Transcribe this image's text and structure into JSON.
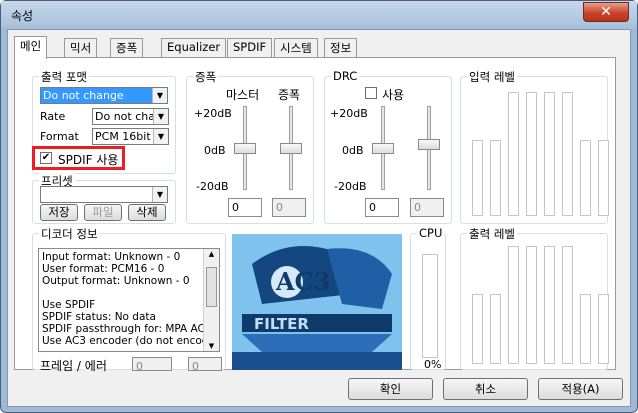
{
  "window": {
    "title": "속성",
    "close": "✕"
  },
  "tabs": [
    "메인",
    "믹서",
    "증폭",
    "Equalizer",
    "SPDIF",
    "시스템",
    "정보"
  ],
  "output_format": {
    "title": "출력 포맷",
    "format_combo": "Do not change",
    "rate_label": "Rate",
    "rate_combo": "Do not char",
    "format_label": "Format",
    "format_value": "PCM 16bit",
    "spdif_checkbox": "SPDIF 사용",
    "spdif_checked": true
  },
  "preset": {
    "title": "프리셋",
    "combo": "",
    "save": "저장",
    "file": "파일",
    "delete": "삭제"
  },
  "amp": {
    "title": "증폭",
    "master": "마스터",
    "gain": "증폭",
    "t20": "+20dB",
    "t0": "0dB",
    "tm20": "-20dB",
    "val1": "0",
    "val2": "0"
  },
  "drc": {
    "title": "DRC",
    "use": "사용",
    "t20": "+20dB",
    "t0": "0dB",
    "tm20": "-20dB",
    "val1": "0",
    "val2": "0"
  },
  "input_level": {
    "title": "입력 레벨"
  },
  "output_level": {
    "title": "출력 레벨"
  },
  "cpu": {
    "title": "CPU",
    "value": "0%"
  },
  "decoder": {
    "title": "디코더 정보",
    "lines": [
      "Input format: Unknown - 0",
      "User format: PCM16 - 0",
      "Output format: Unknown - 0",
      "",
      "Use SPDIF",
      "SPDIF status: No data",
      "  SPDIF passthrough for: MPA AC",
      "  Use AC3 encoder (do not encod"
    ]
  },
  "frames": {
    "label": "프레임 / 에러",
    "val1": "0",
    "val2": "0"
  },
  "logo": {
    "text1": "AC3",
    "text2": "FILTER"
  },
  "buttons": {
    "ok": "확인",
    "cancel": "취소",
    "apply": "적용(A)"
  }
}
